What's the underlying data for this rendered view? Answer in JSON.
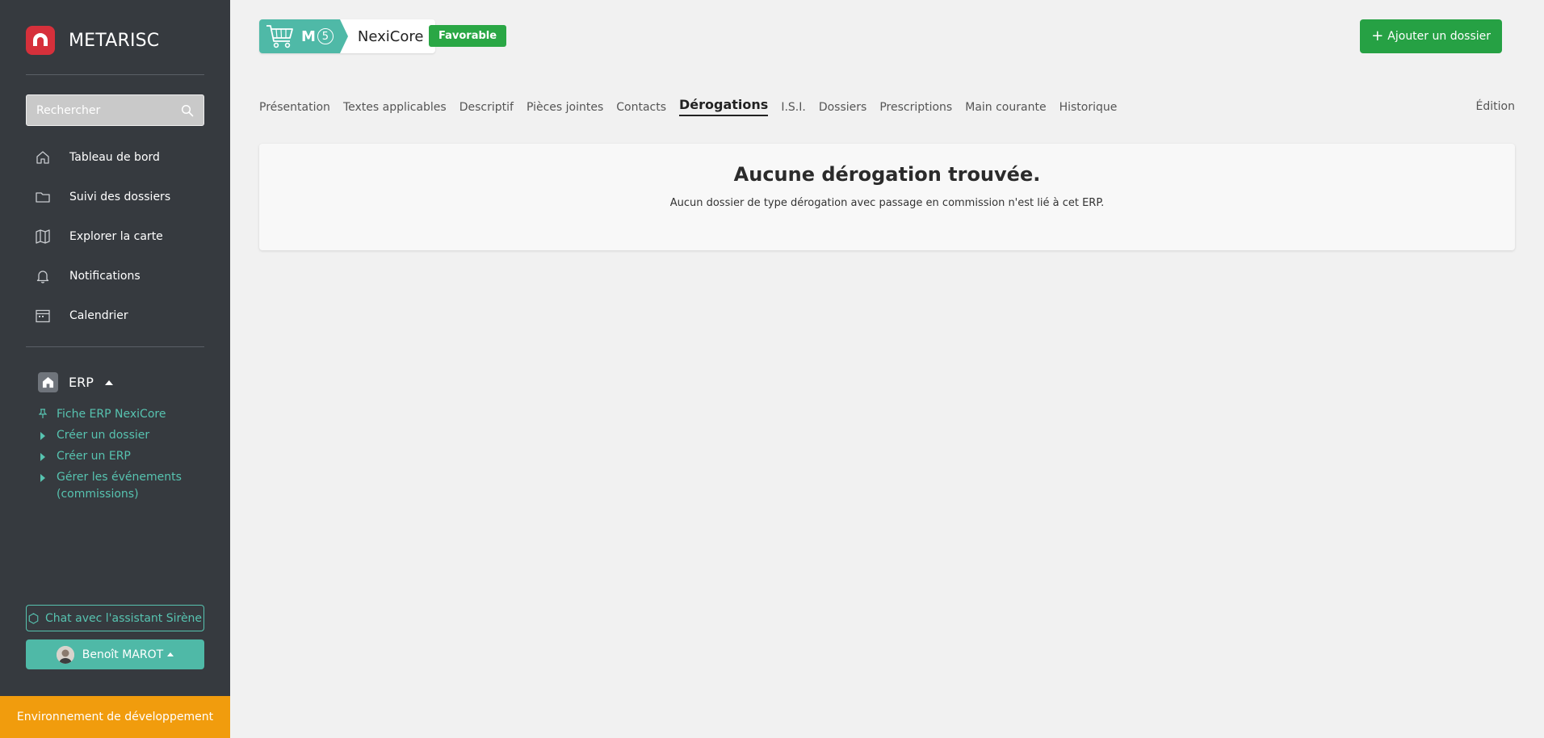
{
  "sidebar": {
    "brand": "METARISC",
    "search": {
      "placeholder": "Rechercher",
      "value": ""
    },
    "nav": [
      {
        "label": "Tableau de bord",
        "icon": "home-icon"
      },
      {
        "label": "Suivi des dossiers",
        "icon": "folder-icon"
      },
      {
        "label": "Explorer la carte",
        "icon": "map-icon"
      },
      {
        "label": "Notifications",
        "icon": "bell-icon"
      },
      {
        "label": "Calendrier",
        "icon": "calendar-icon"
      }
    ],
    "erp_section": {
      "label": "ERP",
      "links": [
        {
          "label": "Fiche ERP NexiCore",
          "icon": "pin-icon"
        },
        {
          "label": "Créer un dossier",
          "icon": "triangle-right-icon"
        },
        {
          "label": "Créer un ERP",
          "icon": "triangle-right-icon"
        },
        {
          "label": "Gérer les événements (commissions)",
          "icon": "triangle-right-icon"
        }
      ]
    },
    "chat_label": "Chat avec l'assistant Sirène",
    "user_name": "Benoît MAROT",
    "env_label": "Environnement de développement"
  },
  "header": {
    "erp_type": "M",
    "erp_category": "5",
    "erp_name": "NexiCore",
    "status": "Favorable",
    "add_button": "Ajouter un dossier",
    "add_symbol": "+"
  },
  "tabs": [
    {
      "label": "Présentation",
      "active": false
    },
    {
      "label": "Textes applicables",
      "active": false
    },
    {
      "label": "Descriptif",
      "active": false
    },
    {
      "label": "Pièces jointes",
      "active": false
    },
    {
      "label": "Contacts",
      "active": false
    },
    {
      "label": "Dérogations",
      "active": true
    },
    {
      "label": "I.S.I.",
      "active": false
    },
    {
      "label": "Dossiers",
      "active": false
    },
    {
      "label": "Prescriptions",
      "active": false
    },
    {
      "label": "Main courante",
      "active": false
    },
    {
      "label": "Historique",
      "active": false
    }
  ],
  "edit_tab": "Édition",
  "empty_state": {
    "title": "Aucune dérogation trouvée.",
    "text": "Aucun dossier de type dérogation avec passage en commission n'est lié à cet ERP."
  },
  "colors": {
    "sidebar_bg": "#363a3f",
    "accent_teal": "#4fb9a7",
    "link_teal": "#57c3b0",
    "brand_red": "#d6303b",
    "success_green": "#26a144",
    "env_orange": "#f19c0d"
  }
}
